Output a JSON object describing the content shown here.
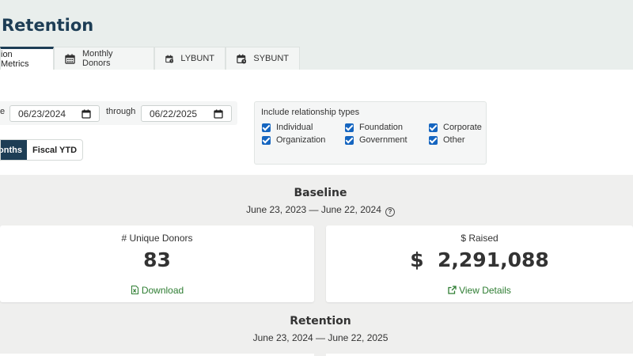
{
  "page": {
    "title": "Retention"
  },
  "tabs": [
    {
      "label": "ion Metrics",
      "icon": "none",
      "active": true
    },
    {
      "label": "Monthly Donors",
      "icon": "calendar-grid-icon",
      "active": false
    },
    {
      "label": "LYBUNT",
      "icon": "calendar-clock-icon",
      "active": false
    },
    {
      "label": "SYBUNT",
      "icon": "calendar-clock-icon",
      "active": false
    }
  ],
  "filters": {
    "since_label": "e",
    "start_date": "06/23/2024",
    "through_label": "through",
    "end_date": "06/22/2025",
    "period_buttons": [
      {
        "label": "onths",
        "active": true
      },
      {
        "label": "Fiscal YTD",
        "active": false
      }
    ]
  },
  "relationships": {
    "title": "Include relationship types",
    "items": [
      {
        "label": "Individual",
        "checked": true
      },
      {
        "label": "Foundation",
        "checked": true
      },
      {
        "label": "Corporate",
        "checked": true
      },
      {
        "label": "Organization",
        "checked": true
      },
      {
        "label": "Government",
        "checked": true
      },
      {
        "label": "Other",
        "checked": true
      }
    ]
  },
  "baseline": {
    "title": "Baseline",
    "dates": "June 23, 2023 — June 22, 2024",
    "help_icon": "question-circle-icon",
    "unique_donors": {
      "label": "# Unique Donors",
      "value": "83",
      "link": "Download",
      "link_icon": "excel-file-icon"
    },
    "raised": {
      "label": "$ Raised",
      "value": "$  2,291,088",
      "link": "View Details",
      "link_icon": "external-link-icon"
    }
  },
  "retention": {
    "title": "Retention",
    "dates": "June 23, 2024 — June 22, 2025"
  },
  "colors": {
    "brand": "#1d3d55",
    "checkbox": "#1565c0",
    "link": "#2e7d32",
    "header_bg": "#e9eeec",
    "section_bg": "#efefee"
  }
}
